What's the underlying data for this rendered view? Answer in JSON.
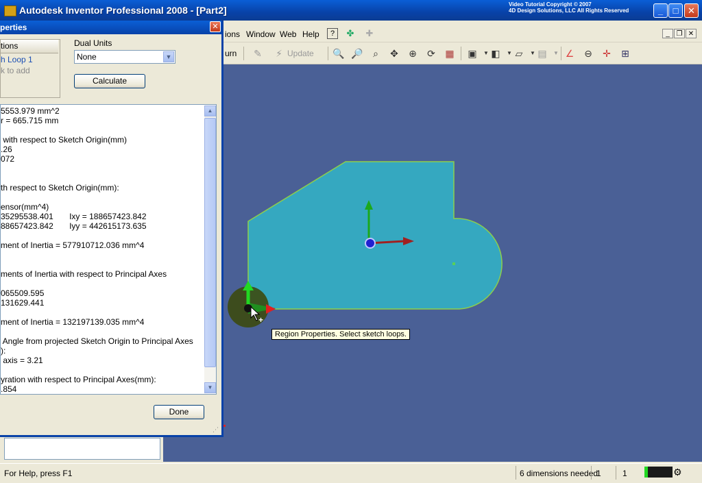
{
  "app": {
    "title": "Autodesk Inventor Professional 2008 - [Part2]",
    "copyright_line1": "Video Tutorial Copyright © 2007",
    "copyright_line2": "4D Design Solutions, LLC All Rights Reserved",
    "win_minimize": "_",
    "win_maximize": "□",
    "win_close": "✕"
  },
  "menu": {
    "items": [
      {
        "label": "ions"
      },
      {
        "label": "Window"
      },
      {
        "label": "Web"
      },
      {
        "label": "Help"
      }
    ],
    "mdi_minimize": "_",
    "mdi_restore": "❐",
    "mdi_close": "✕"
  },
  "toolbar": {
    "return_label": "urn",
    "update_label": "Update"
  },
  "dialog": {
    "title": "perties",
    "close": "✕",
    "sections_header": "tions",
    "sections_item": "h Loop 1",
    "sections_hint": "k to add",
    "dual_units_label": "Dual Units",
    "dual_units_value": "None",
    "calculate_label": "Calculate",
    "done_label": "Done",
    "results": [
      "5553.979 mm^2",
      "r = 665.715 mm",
      "",
      " with respect to Sketch Origin(mm)",
      ".26",
      "072",
      "",
      "",
      "th respect to Sketch Origin(mm):",
      "",
      "ensor(mm^4)",
      "35295538.401       Ixy = 188657423.842",
      "88657423.842       Iyy = 442615173.635",
      "",
      "ment of Inertia = 577910712.036 mm^4",
      "",
      "",
      "ments of Inertia with respect to Principal Axes",
      "",
      "065509.595",
      "131629.441",
      "",
      "ment of Inertia = 132197139.035 mm^4",
      "",
      " Angle from projected Sketch Origin to Principal Axes",
      "):",
      " axis = 3.21",
      "",
      "yration with respect to Principal Axes(mm):",
      ".854"
    ]
  },
  "viewport": {
    "tooltip": "Region Properties. Select sketch loops.",
    "colors": {
      "background": "#4a6096",
      "region": "#35a8c0",
      "edge": "#8ecf4a"
    }
  },
  "status": {
    "help": "For Help, press F1",
    "dimensions": "6 dimensions needed",
    "field1": "1",
    "field2": "1"
  }
}
